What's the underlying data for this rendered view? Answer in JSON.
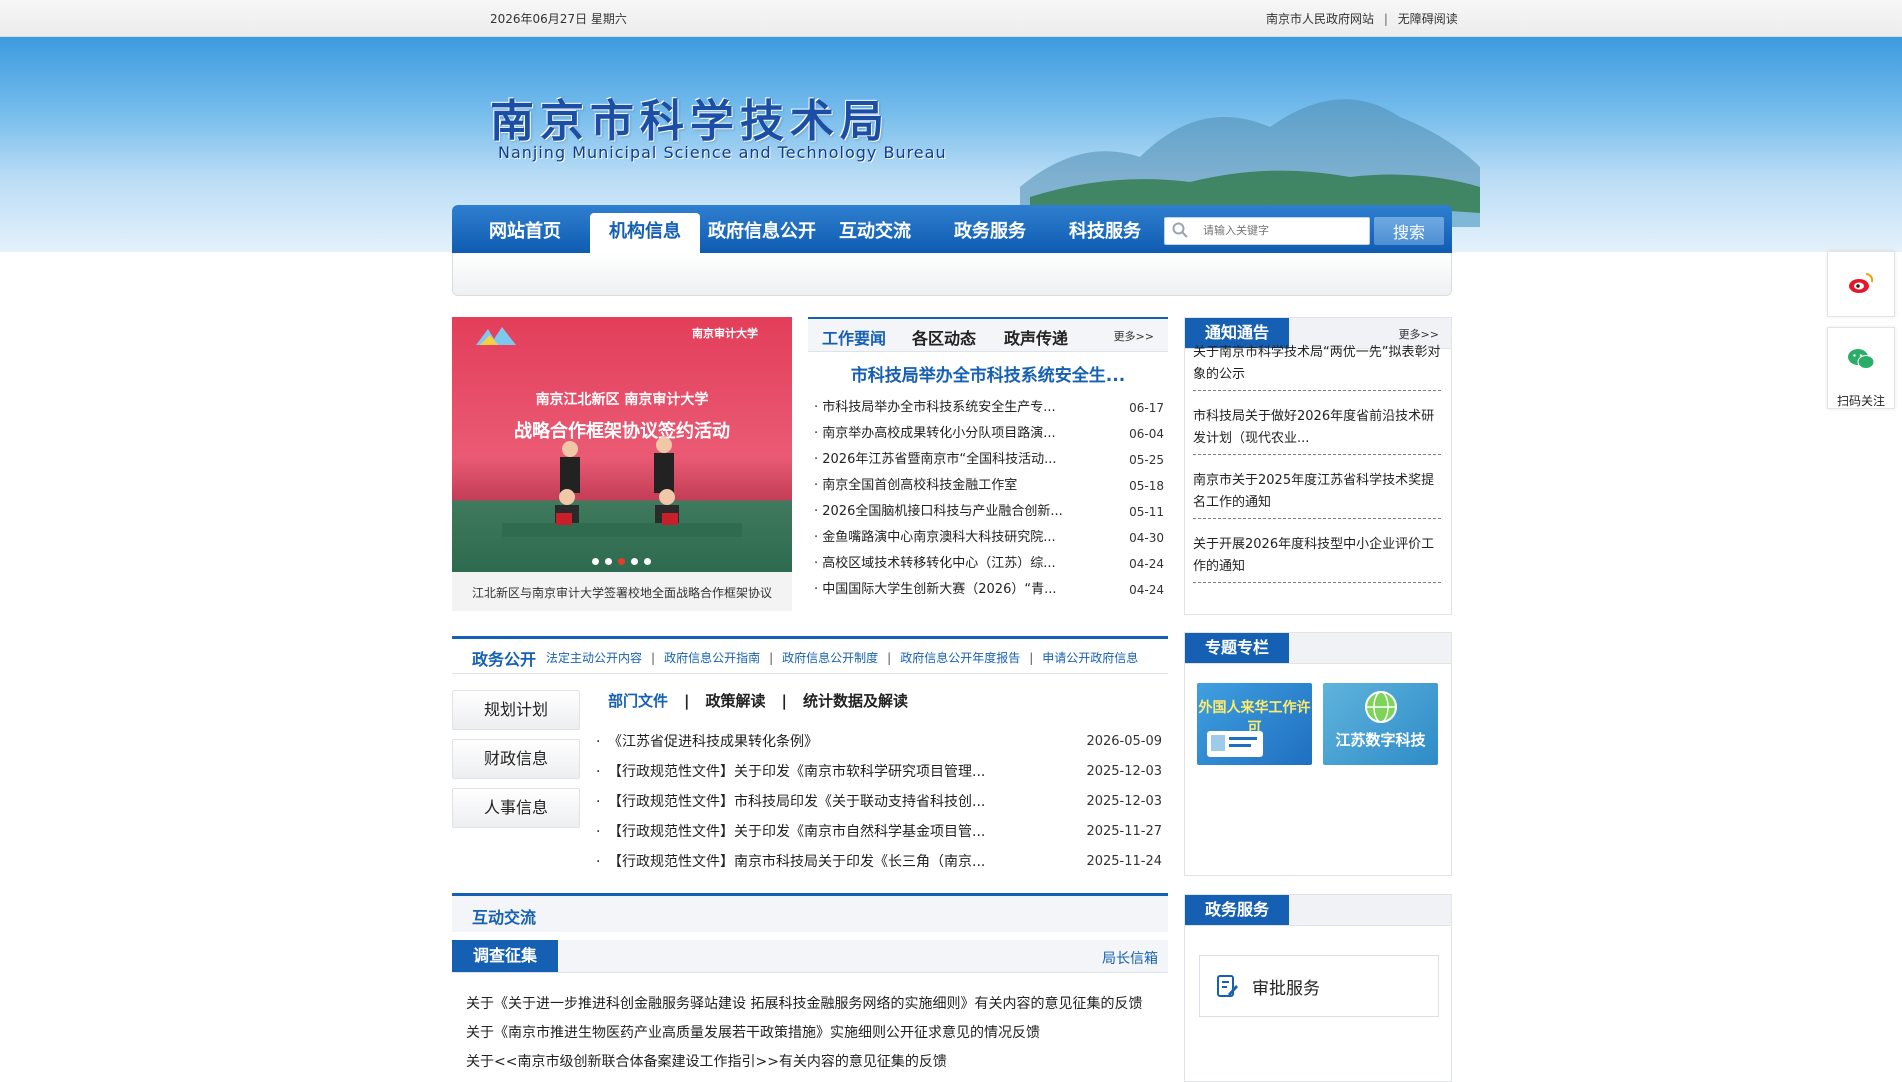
{
  "topbar": {
    "date": "2026年06月27日  星期六",
    "gov_link": "南京市人民政府网站",
    "separator": "|",
    "accessibility_link": "无障碍阅读"
  },
  "header": {
    "title": "南京市科学技术局",
    "subtitle": "Nanjing Municipal Science and Technology Bureau"
  },
  "nav": {
    "items": [
      "网站首页",
      "机构信息",
      "政府信息公开",
      "互动交流",
      "政务服务",
      "科技服务"
    ],
    "active_index": 1,
    "search_placeholder": "请输入关键字",
    "search_button": "搜索"
  },
  "carousel": {
    "slide_title_line1": "南京江北新区  南京审计大学",
    "slide_title_line2": "战略合作框架协议签约活动",
    "slide_logo_right": "南京审计大学",
    "caption": "江北新区与南京审计大学签署校地全面战略合作框架协议",
    "dot_count": 5,
    "active_dot": 2
  },
  "news": {
    "tabs": [
      "工作要闻",
      "各区动态",
      "政声传递"
    ],
    "more": "更多>>",
    "headline": "市科技局举办全市科技系统安全生...",
    "items": [
      {
        "title": "市科技局举办全市科技系统安全生产专...",
        "date": "06-17"
      },
      {
        "title": "南京举办高校成果转化小分队项目路演...",
        "date": "06-04"
      },
      {
        "title": "2026年江苏省暨南京市“全国科技活动...",
        "date": "05-25"
      },
      {
        "title": "南京全国首创高校科技金融工作室",
        "date": "05-18"
      },
      {
        "title": "2026全国脑机接口科技与产业融合创新...",
        "date": "05-11"
      },
      {
        "title": "金鱼嘴路演中心南京澳科大科技研究院...",
        "date": "04-30"
      },
      {
        "title": "高校区域技术转移转化中心（江苏）综...",
        "date": "04-24"
      },
      {
        "title": "中国国际大学生创新大赛（2026）“青...",
        "date": "04-24"
      }
    ]
  },
  "notice": {
    "label": "通知通告",
    "more": "更多>>",
    "items": [
      "关于南京市科学技术局“两优一先”拟表彰对象的公示",
      "市科技局关于做好2026年度省前沿技术研发计划（现代农业...",
      "南京市关于2025年度江苏省科学技术奖提名工作的通知",
      "关于开展2026年度科技型中小企业评价工作的通知"
    ]
  },
  "zwgk": {
    "title": "政务公开",
    "links": [
      "法定主动公开内容",
      "政府信息公开指南",
      "政府信息公开制度",
      "政府信息公开年度报告",
      "申请公开政府信息"
    ],
    "side_buttons": [
      "规划计划",
      "财政信息",
      "人事信息"
    ],
    "doc_tabs": [
      "部门文件",
      "政策解读",
      "统计数据及解读"
    ],
    "docs": [
      {
        "title": "《江苏省促进科技成果转化条例》",
        "date": "2026-05-09"
      },
      {
        "title": "【行政规范性文件】关于印发《南京市软科学研究项目管理...",
        "date": "2025-12-03"
      },
      {
        "title": "【行政规范性文件】市科技局印发《关于联动支持省科技创...",
        "date": "2025-12-03"
      },
      {
        "title": "【行政规范性文件】关于印发《南京市自然科学基金项目管...",
        "date": "2025-11-27"
      },
      {
        "title": "【行政规范性文件】南京市科技局关于印发《长三角（南京...",
        "date": "2025-11-24"
      }
    ]
  },
  "special": {
    "label": "专题专栏",
    "tile1": "外国人来华工作许可",
    "tile2": "江苏数字科技"
  },
  "interaction": {
    "title": "互动交流",
    "survey_label": "调查征集",
    "mailbox": "局长信箱",
    "items": [
      "关于《关于进一步推进科创金融服务驿站建设  拓展科技金融服务网络的实施细则》有关内容的意见征集的反馈",
      "关于《南京市推进生物医药产业高质量发展若干政策措施》实施细则公开征求意见的情况反馈",
      "关于<<南京市级创新联合体备案建设工作指引>>有关内容的意见征集的反馈"
    ]
  },
  "service": {
    "label": "政务服务",
    "approval": "审批服务"
  },
  "float": {
    "wechat_caption": "扫码关注"
  },
  "colors": {
    "primary": "#1660b3",
    "accent_red": "#e53b2d"
  }
}
